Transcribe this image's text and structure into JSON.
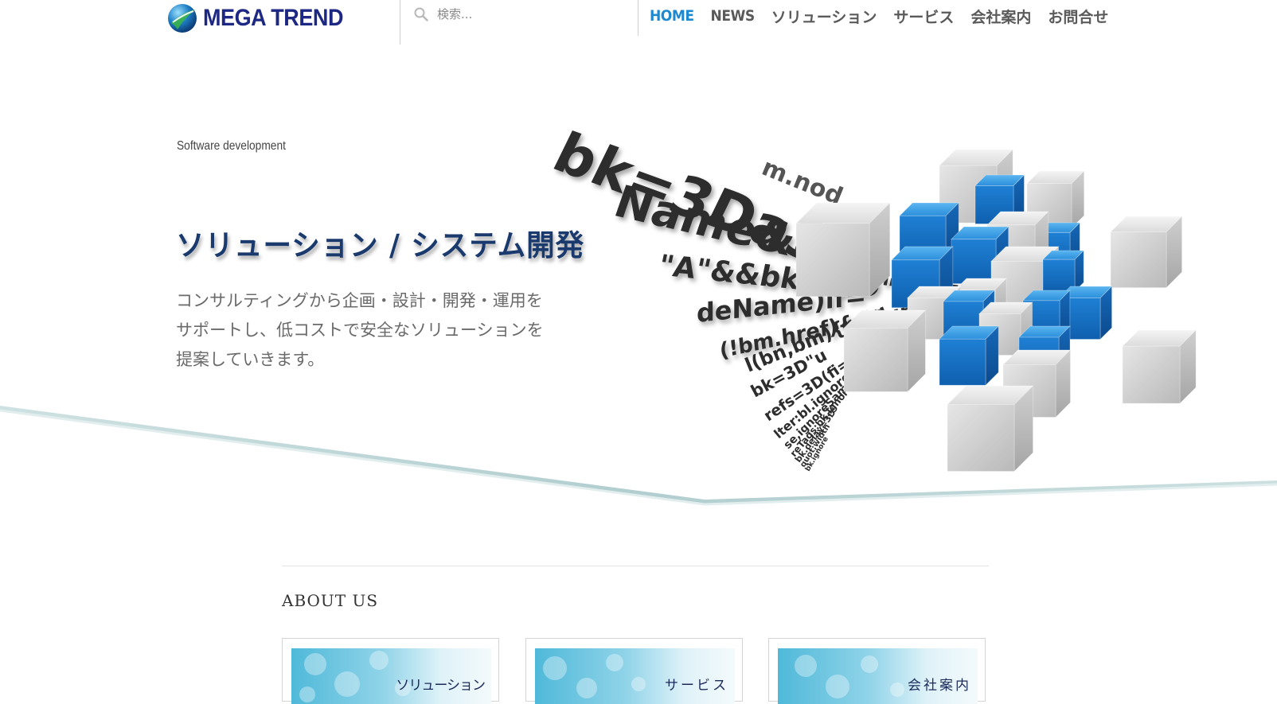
{
  "header": {
    "logo_text": "MEGA TREND",
    "search_placeholder": "検索...",
    "nav": [
      "HOME",
      "NEWS",
      "ソリューション",
      "サービス",
      "会社案内",
      "お問合せ"
    ]
  },
  "hero": {
    "tagline": "Software development",
    "title": "ソリューション / システム開発",
    "description_lines": [
      "コンサルティングから企画・設計・開発・運用を",
      "サポートし、低コストで安全なソリューションを",
      "提案していきます。"
    ],
    "code_lines": [
      "bk=3Da3(b",
      "m.nod",
      "Name&&((",
      "\"A\"&&bk!=3D\"AREA\")",
      "deName)if=",
      "(!bm.href){return false",
      "l(bn,bm){retu",
      "bk=3D\"u",
      "refs=3D(fi=",
      "lter:bl.ignore",
      "se,ignoreSame",
      "reTags:bk.ignore",
      "bk.delay=3D\"",
      "quot;width",
      "bk.ignore"
    ]
  },
  "colors": {
    "nav_active": "#1e88d0",
    "logo_blue": "#1d2784",
    "title_navy": "#1a3a6e",
    "cube_blue": "#1f7fd0"
  },
  "about": {
    "title": "ABOUT US",
    "cards": [
      {
        "label": "ソリューション"
      },
      {
        "label": "サービス"
      },
      {
        "label": "会社案内"
      }
    ]
  }
}
